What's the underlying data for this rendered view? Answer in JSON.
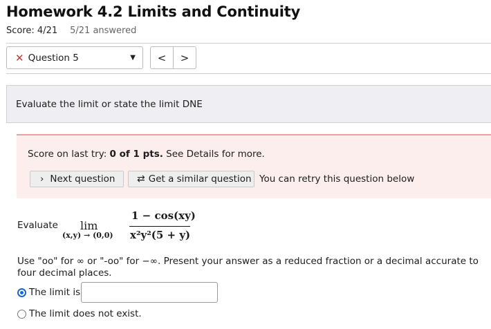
{
  "header": {
    "title": "Homework 4.2 Limits and Continuity",
    "score": "Score: 4/21",
    "answered": "5/21 answered"
  },
  "nav": {
    "question_label": "Question 5",
    "status_icon": "x-mark-icon",
    "prev_label": "<",
    "next_label": ">"
  },
  "prompt": "Evaluate the limit or state the limit DNE",
  "feedback": {
    "score_prefix": "Score on last try: ",
    "score_value": "0 of 1 pts.",
    "score_suffix": " See Details for more.",
    "next_question_label": "Next question",
    "similar_question_label": "Get a similar question",
    "retry_note": "You can retry this question below"
  },
  "problem": {
    "evaluate_label": "Evaluate",
    "lim": "lim",
    "lim_sub": "(x,y) → (0,0)",
    "numerator": "1 − cos(xy)",
    "denominator": "x²y²(5 + y)",
    "instructions": "Use \"oo\" for ∞ or \"-oo\" for −∞. Present your answer as a reduced fraction or a decimal accurate to four decimal places."
  },
  "options": {
    "limit_is": "The limit is",
    "dne": "The limit does not exist.",
    "selected": "limit_is",
    "answer_value": ""
  }
}
